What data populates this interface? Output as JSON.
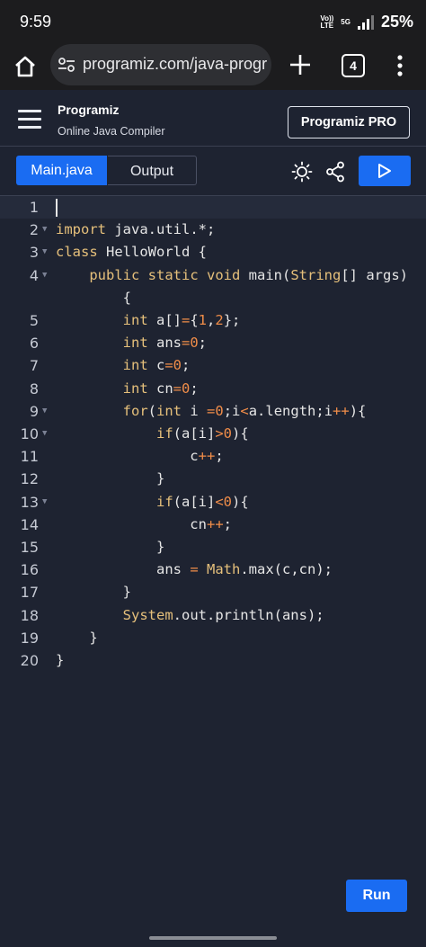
{
  "status_bar": {
    "time": "9:59",
    "volte": "Vo)) LTE",
    "network": "5G",
    "battery": "25%"
  },
  "browser": {
    "url": "programiz.com/java-programi",
    "tab_count": "4"
  },
  "site": {
    "logo": "Programiz",
    "subtitle": "Online Java Compiler",
    "pro_button": "Programiz PRO"
  },
  "toolbar": {
    "tab_main": "Main.java",
    "tab_output": "Output"
  },
  "editor": {
    "lines": [
      {
        "n": "1",
        "text": ""
      },
      {
        "n": "2",
        "text": "import java.util.*;"
      },
      {
        "n": "3",
        "text": "class HelloWorld {"
      },
      {
        "n": "4",
        "text": "    public static void main(String[] args)"
      },
      {
        "n": "",
        "text": "        {"
      },
      {
        "n": "5",
        "text": "        int a[]={1,2};"
      },
      {
        "n": "6",
        "text": "        int ans=0;"
      },
      {
        "n": "7",
        "text": "        int c=0;"
      },
      {
        "n": "8",
        "text": "        int cn=0;"
      },
      {
        "n": "9",
        "text": "        for(int i =0;i<a.length;i++){"
      },
      {
        "n": "10",
        "text": "            if(a[i]>0){"
      },
      {
        "n": "11",
        "text": "                c++;"
      },
      {
        "n": "12",
        "text": "            }"
      },
      {
        "n": "13",
        "text": "            if(a[i]<0){"
      },
      {
        "n": "14",
        "text": "                cn++;"
      },
      {
        "n": "15",
        "text": "            }"
      },
      {
        "n": "16",
        "text": "            ans = Math.max(c,cn);"
      },
      {
        "n": "17",
        "text": "        }"
      },
      {
        "n": "18",
        "text": "        System.out.println(ans);"
      },
      {
        "n": "19",
        "text": "    }"
      },
      {
        "n": "20",
        "text": "}"
      }
    ]
  },
  "run_button": "Run",
  "colors": {
    "accent": "#1a6cf2",
    "background": "#1e2331",
    "keyword": "#e6c07b",
    "number": "#f08d49"
  }
}
